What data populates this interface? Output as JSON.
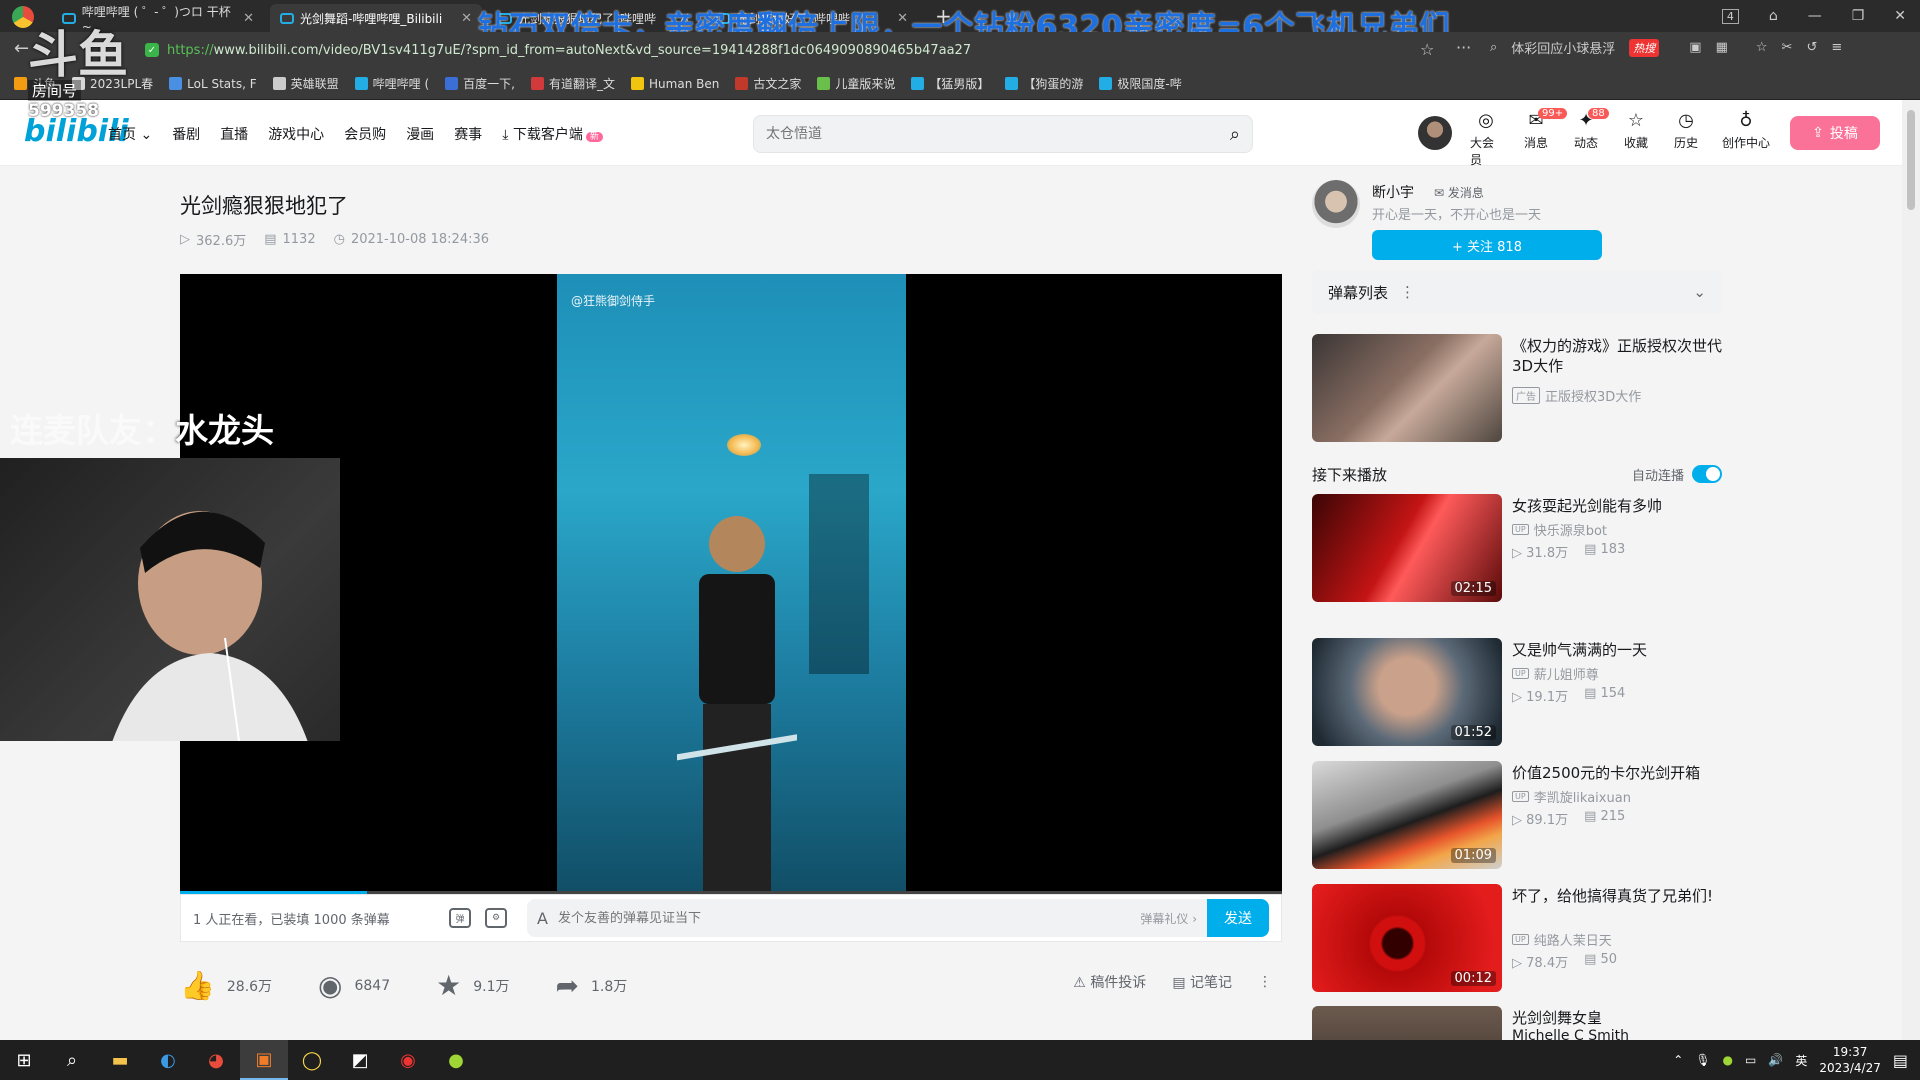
{
  "browser": {
    "tabs": [
      {
        "label": "哔哩哔哩 ( ゜- ゜)つロ 干杯~",
        "active": false
      },
      {
        "label": "光剑舞蹈-哔哩哔哩_Bilibili",
        "active": true
      },
      {
        "label": "光剑瘾狠狠地犯了_哔哩哔",
        "active": false
      },
      {
        "label": "光剑舞蹈好了_哔哩哔",
        "active": false
      }
    ],
    "window_counter": "4",
    "url_scheme": "https://",
    "url_rest": "www.bilibili.com/video/BV1sv411g7uE/?spm_id_from=autoNext&vd_source=19414288f1dc0649090890465b47aa27",
    "search_hint": "体彩回应小球悬浮",
    "hot_label": "热搜",
    "bookmarks": [
      "斗鱼",
      "2023LPL春",
      "LoL Stats, F",
      "英雄联盟",
      "哔哩哔哩 (",
      "百度一下,",
      "有道翻译_文",
      "Human Ben",
      "古文之家",
      "儿童版来说",
      "【猛男版】",
      "【狗蛋的游",
      "极限国度-哔"
    ]
  },
  "overlay": {
    "banner": "钻石双倍卡，亲密度翻倍上限，一个钻粉6320亲密度=6个飞机兄弟们",
    "logo_big": "斗鱼",
    "logo_small": "房间号",
    "room_number": "599358",
    "cam_label_prefix": "连麦队友：",
    "cam_label_name": "水龙头"
  },
  "header": {
    "logo": "bilibili",
    "nav": [
      "首页",
      "番剧",
      "直播",
      "游戏中心",
      "会员购",
      "漫画",
      "赛事"
    ],
    "download_label": "下载客户端",
    "download_badge": "新",
    "search_placeholder": "太仓悟道",
    "right_items": [
      {
        "label": "大会员",
        "icon": "vip-icon",
        "badge": ""
      },
      {
        "label": "消息",
        "icon": "message-icon",
        "badge": "99+"
      },
      {
        "label": "动态",
        "icon": "dynamic-icon",
        "badge": "88"
      },
      {
        "label": "收藏",
        "icon": "star-icon",
        "badge": ""
      },
      {
        "label": "历史",
        "icon": "clock-icon",
        "badge": ""
      },
      {
        "label": "创作中心",
        "icon": "bulb-icon",
        "badge": ""
      }
    ],
    "upload_label": "投稿"
  },
  "video": {
    "title": "光剑瘾狠狠地犯了",
    "views": "362.6万",
    "danmaku_count": "1132",
    "date": "2021-10-08 18:24:36",
    "watermark": "@狂熊御剑侍手",
    "progress_fraction": 0.17
  },
  "danmaku_bar": {
    "status": "1 人正在看，已装填 1000 条弹幕",
    "input_placeholder": "发个友善的弹幕见证当下",
    "etiquette": "弹幕礼仪 ›",
    "send": "发送"
  },
  "toolbar": {
    "like": "28.6万",
    "coin": "6847",
    "fav": "9.1万",
    "share": "1.8万",
    "report": "稿件投诉",
    "notes": "记笔记"
  },
  "uploader": {
    "name": "断小宇",
    "message": "发消息",
    "sign": "开心是一天，不开心也是一天",
    "follow": "+ 关注 818"
  },
  "right": {
    "danmaku_list": "弹幕列表",
    "ad": {
      "title": "《权力的游戏》正版授权次世代3D大作",
      "tag": "广告",
      "sub": "正版授权3D大作"
    },
    "next_play": "接下来播放",
    "autoplay": "自动连播",
    "autoplay_on": true,
    "videos": [
      {
        "title": "女孩耍起光剑能有多帅",
        "up": "快乐源泉bot",
        "views": "31.8万",
        "danmaku": "183",
        "duration": "02:15"
      },
      {
        "title": "又是帅气满满的一天",
        "up": "薪儿姐师尊",
        "views": "19.1万",
        "danmaku": "154",
        "duration": "01:52"
      },
      {
        "title": "价值2500元的卡尔光剑开箱",
        "up": "李凯旋likaixuan",
        "views": "89.1万",
        "danmaku": "215",
        "duration": "01:09"
      },
      {
        "title": "坏了，给他搞得真货了兄弟们!",
        "up": "纯路人茉日天",
        "views": "78.4万",
        "danmaku": "50",
        "duration": "00:12"
      },
      {
        "title": "光剑剑舞女皇",
        "up": "Michelle C Smith",
        "views": "",
        "danmaku": "",
        "duration": ""
      }
    ]
  },
  "taskbar": {
    "lang": "英",
    "time": "19:37",
    "date": "2023/4/27"
  },
  "colors": {
    "bili_blue": "#00aeec",
    "bili_pink": "#fb7299",
    "banner_blue": "#1e6fe0"
  }
}
